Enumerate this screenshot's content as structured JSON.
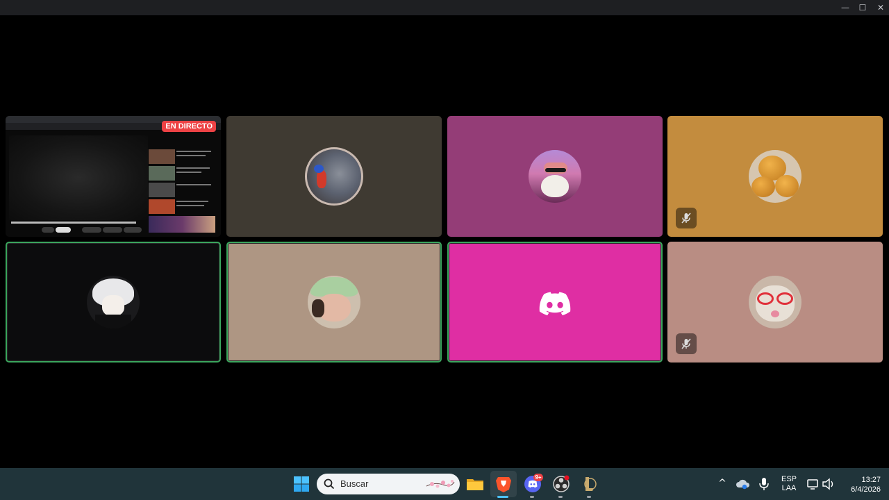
{
  "window": {
    "controls": {
      "minimize": "—",
      "maximize": "☐",
      "close": "✕"
    }
  },
  "stream": {
    "live_label": "EN DIRECTO"
  },
  "tiles": [
    {
      "id": "stream",
      "kind": "screen-share",
      "bg": "#0a0a0a",
      "speaking": false,
      "muted": false
    },
    {
      "id": "tile-2",
      "kind": "avatar",
      "bg": "#3f3a32",
      "speaking": false,
      "muted": false,
      "avatar_icon": "cartoon-cat-avatar"
    },
    {
      "id": "tile-3",
      "kind": "avatar",
      "bg": "#943d77",
      "speaking": false,
      "muted": false,
      "avatar_icon": "bearded-old-man-avatar"
    },
    {
      "id": "tile-4",
      "kind": "avatar",
      "bg": "#c38c3e",
      "speaking": false,
      "muted": true,
      "avatar_icon": "bread-rolls-avatar"
    },
    {
      "id": "tile-5",
      "kind": "avatar",
      "bg": "#0c0c0d",
      "speaking": true,
      "muted": false,
      "avatar_icon": "anime-white-hair-avatar"
    },
    {
      "id": "tile-6",
      "kind": "avatar",
      "bg": "#ae9683",
      "speaking": true,
      "muted": false,
      "avatar_icon": "cap-person-avatar"
    },
    {
      "id": "tile-7",
      "kind": "default-avatar",
      "bg": "#df2ea3",
      "speaking": true,
      "muted": false,
      "avatar_icon": "discord-logo-icon"
    },
    {
      "id": "tile-8",
      "kind": "avatar",
      "bg": "#b98d83",
      "speaking": false,
      "muted": true,
      "avatar_icon": "cat-glasses-avatar"
    }
  ],
  "taskbar": {
    "search_label": "Buscar",
    "discord_badge": "9+",
    "lang_line1": "ESP",
    "lang_line2": "LAA",
    "time": "13:27",
    "date": "6/4/2026",
    "tray_up_arrow": "^"
  },
  "colors": {
    "speaking_ring": "#3ba55d",
    "live_red": "#ed4245",
    "taskbar_bg": "#20343a"
  }
}
